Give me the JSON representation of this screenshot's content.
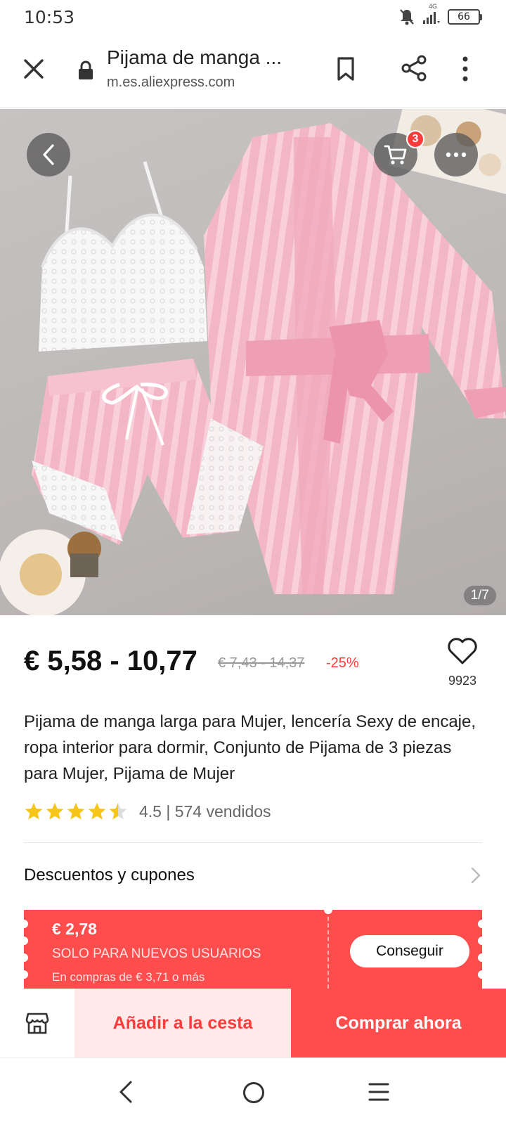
{
  "status_bar": {
    "time": "10:53",
    "network": "4G",
    "battery": "66"
  },
  "browser": {
    "title": "Pijama de manga ...",
    "url": "m.es.aliexpress.com"
  },
  "gallery": {
    "counter": "1/7",
    "cart_count": "3"
  },
  "product": {
    "price": "€ 5,58 - 10,77",
    "original_price": "€ 7,43 - 14,37",
    "discount": "-25%",
    "wishlist_count": "9923",
    "title": "Pijama de manga larga para Mujer, lencería Sexy de encaje, ropa interior para dormir, Conjunto de Pijama de 3 piezas para Mujer, Pijama de Mujer",
    "rating_value": 4.5,
    "rating_text": "4.5 | 574 vendidos"
  },
  "coupons": {
    "section_label": "Descuentos y cupones",
    "amount": "€ 2,78",
    "audience": "SOLO PARA NUEVOS USUARIOS",
    "condition": "En compras de € 3,71 o más",
    "button_label": "Conseguir"
  },
  "actions": {
    "add_to_cart": "Añadir a la cesta",
    "buy_now": "Comprar ahora"
  },
  "colors": {
    "accent": "#ff4c4c",
    "star": "#f5c518",
    "add_cart_bg": "#ffe9e9"
  }
}
